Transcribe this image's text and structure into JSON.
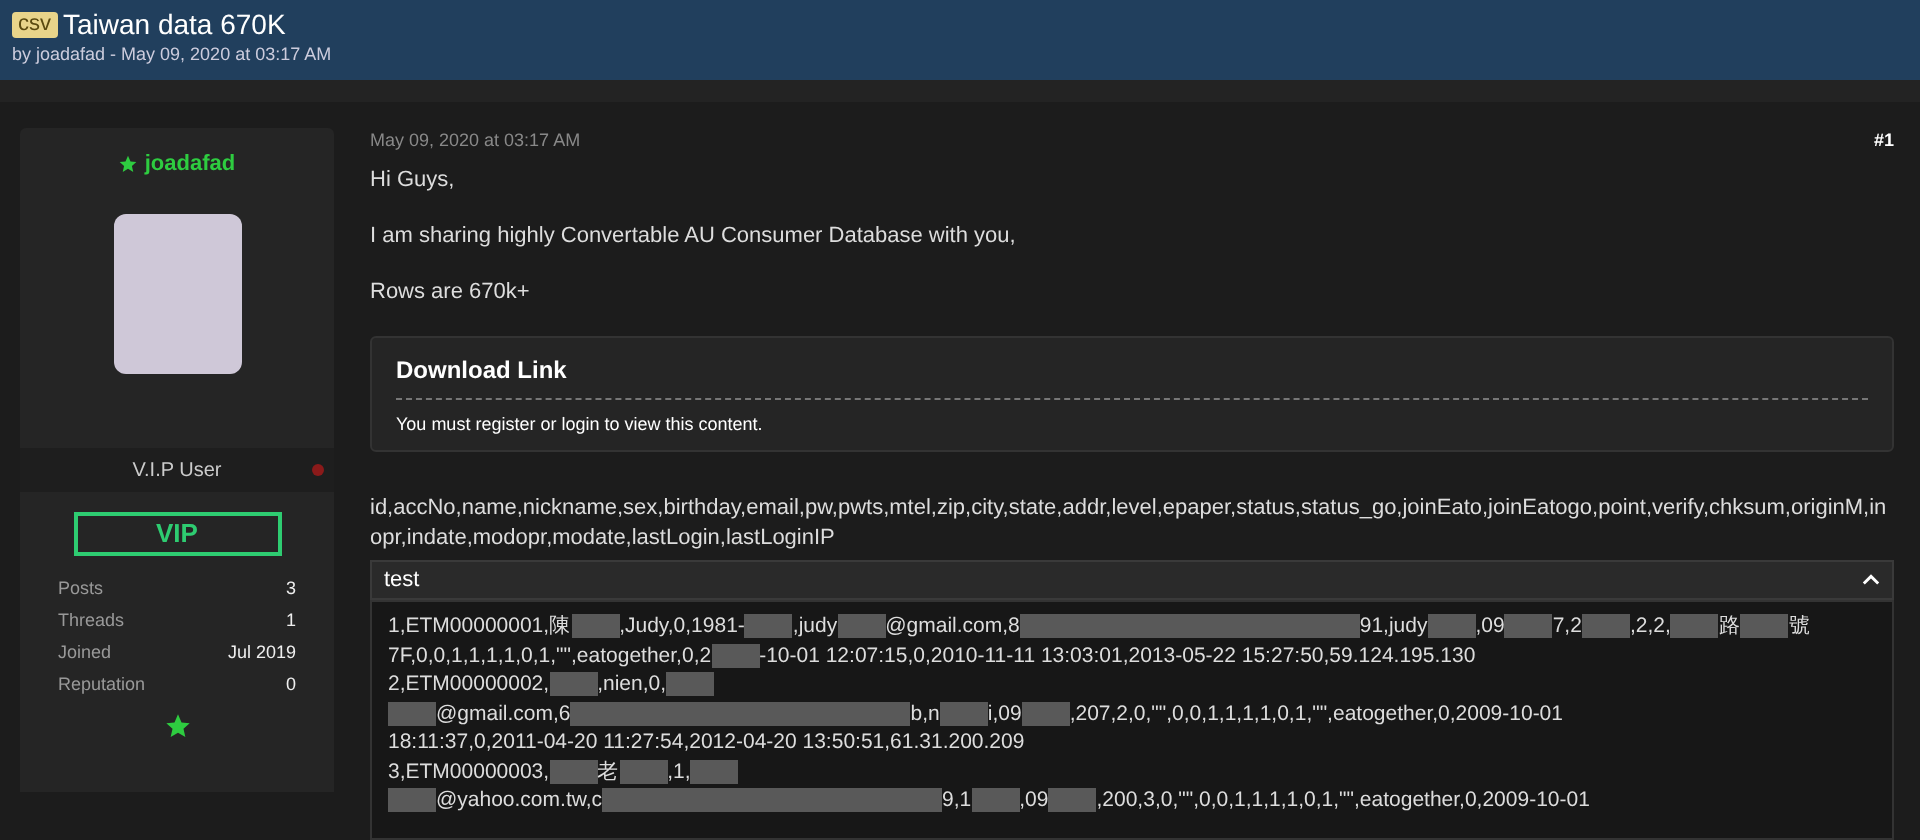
{
  "thread": {
    "tag": "csv",
    "title": "Taiwan data 670K",
    "byline": "by joadafad - May 09, 2020 at 03:17 AM"
  },
  "user": {
    "name": "joadafad",
    "role": "V.I.P User",
    "online": false,
    "badge": "VIP",
    "stats": [
      {
        "label": "Posts",
        "value": "3"
      },
      {
        "label": "Threads",
        "value": "1"
      },
      {
        "label": "Joined",
        "value": "Jul 2019"
      },
      {
        "label": "Reputation",
        "value": "0"
      }
    ]
  },
  "post": {
    "date": "May 09, 2020 at 03:17 AM",
    "number": "#1",
    "paragraphs": [
      "Hi Guys,",
      "I am sharing highly Convertable AU Consumer Database with you,",
      "Rows are 670k+"
    ],
    "hidden_box": {
      "title": "Download Link",
      "message": "You must register or login to view this content."
    },
    "header_line": "id,accNo,name,nickname,sex,birthday,email,pw,pwts,mtel,zip,city,state,addr,level,epaper,status,status_go,joinEato,joinEatogo,point,verify,chksum,originM,inopr,indate,modopr,modate,lastLogin,lastLoginIP",
    "spoiler": {
      "title": "test",
      "expanded": true,
      "lines": [
        [
          {
            "kind": "text",
            "text": "1,ETM00000001,陳"
          },
          {
            "kind": "redacted"
          },
          {
            "kind": "text",
            "text": ",Judy,0,1981-"
          },
          {
            "kind": "redacted"
          },
          {
            "kind": "text",
            "text": ",judy"
          },
          {
            "kind": "redacted"
          },
          {
            "kind": "text",
            "text": "@gmail.com,8"
          },
          {
            "kind": "redactedlong"
          },
          {
            "kind": "text",
            "text": "91,judy"
          },
          {
            "kind": "redacted"
          },
          {
            "kind": "text",
            "text": ",09"
          },
          {
            "kind": "redacted"
          },
          {
            "kind": "text",
            "text": "7,2"
          },
          {
            "kind": "redacted"
          },
          {
            "kind": "text",
            "text": ",2,2,"
          },
          {
            "kind": "redacted"
          },
          {
            "kind": "text",
            "text": "路"
          },
          {
            "kind": "redacted"
          },
          {
            "kind": "text",
            "text": "號"
          }
        ],
        [
          {
            "kind": "text",
            "text": "7F,0,0,1,1,1,1,0,1,\"\",eatogether,0,2"
          },
          {
            "kind": "redacted"
          },
          {
            "kind": "text",
            "text": "-10-01 12:07:15,0,2010-11-11 13:03:01,2013-05-22 15:27:50,59.124.195.130"
          }
        ],
        [
          {
            "kind": "text",
            "text": "2,ETM00000002,"
          },
          {
            "kind": "redacted"
          },
          {
            "kind": "text",
            "text": ",nien,0,"
          },
          {
            "kind": "redacted"
          }
        ],
        [
          {
            "kind": "redacted"
          },
          {
            "kind": "text",
            "text": "@gmail.com,6"
          },
          {
            "kind": "redactedlong"
          },
          {
            "kind": "text",
            "text": "b,n"
          },
          {
            "kind": "redacted"
          },
          {
            "kind": "text",
            "text": "i,09"
          },
          {
            "kind": "redacted"
          },
          {
            "kind": "text",
            "text": ",207,2,0,\"\",0,0,1,1,1,1,0,1,\"\",eatogether,0,2009-10-01"
          }
        ],
        [
          {
            "kind": "text",
            "text": "18:11:37,0,2011-04-20 11:27:54,2012-04-20 13:50:51,61.31.200.209"
          }
        ],
        [
          {
            "kind": "text",
            "text": "3,ETM00000003,"
          },
          {
            "kind": "redacted"
          },
          {
            "kind": "text",
            "text": "老"
          },
          {
            "kind": "redacted"
          },
          {
            "kind": "text",
            "text": ",1,"
          },
          {
            "kind": "redacted"
          }
        ],
        [
          {
            "kind": "redacted"
          },
          {
            "kind": "text",
            "text": "@yahoo.com.tw,c"
          },
          {
            "kind": "redactedlong"
          },
          {
            "kind": "text",
            "text": "9,1"
          },
          {
            "kind": "redacted"
          },
          {
            "kind": "text",
            "text": ",09"
          },
          {
            "kind": "redacted"
          },
          {
            "kind": "text",
            "text": ",200,3,0,\"\",0,0,1,1,1,1,0,1,\"\",eatogether,0,2009-10-01"
          }
        ]
      ]
    }
  }
}
